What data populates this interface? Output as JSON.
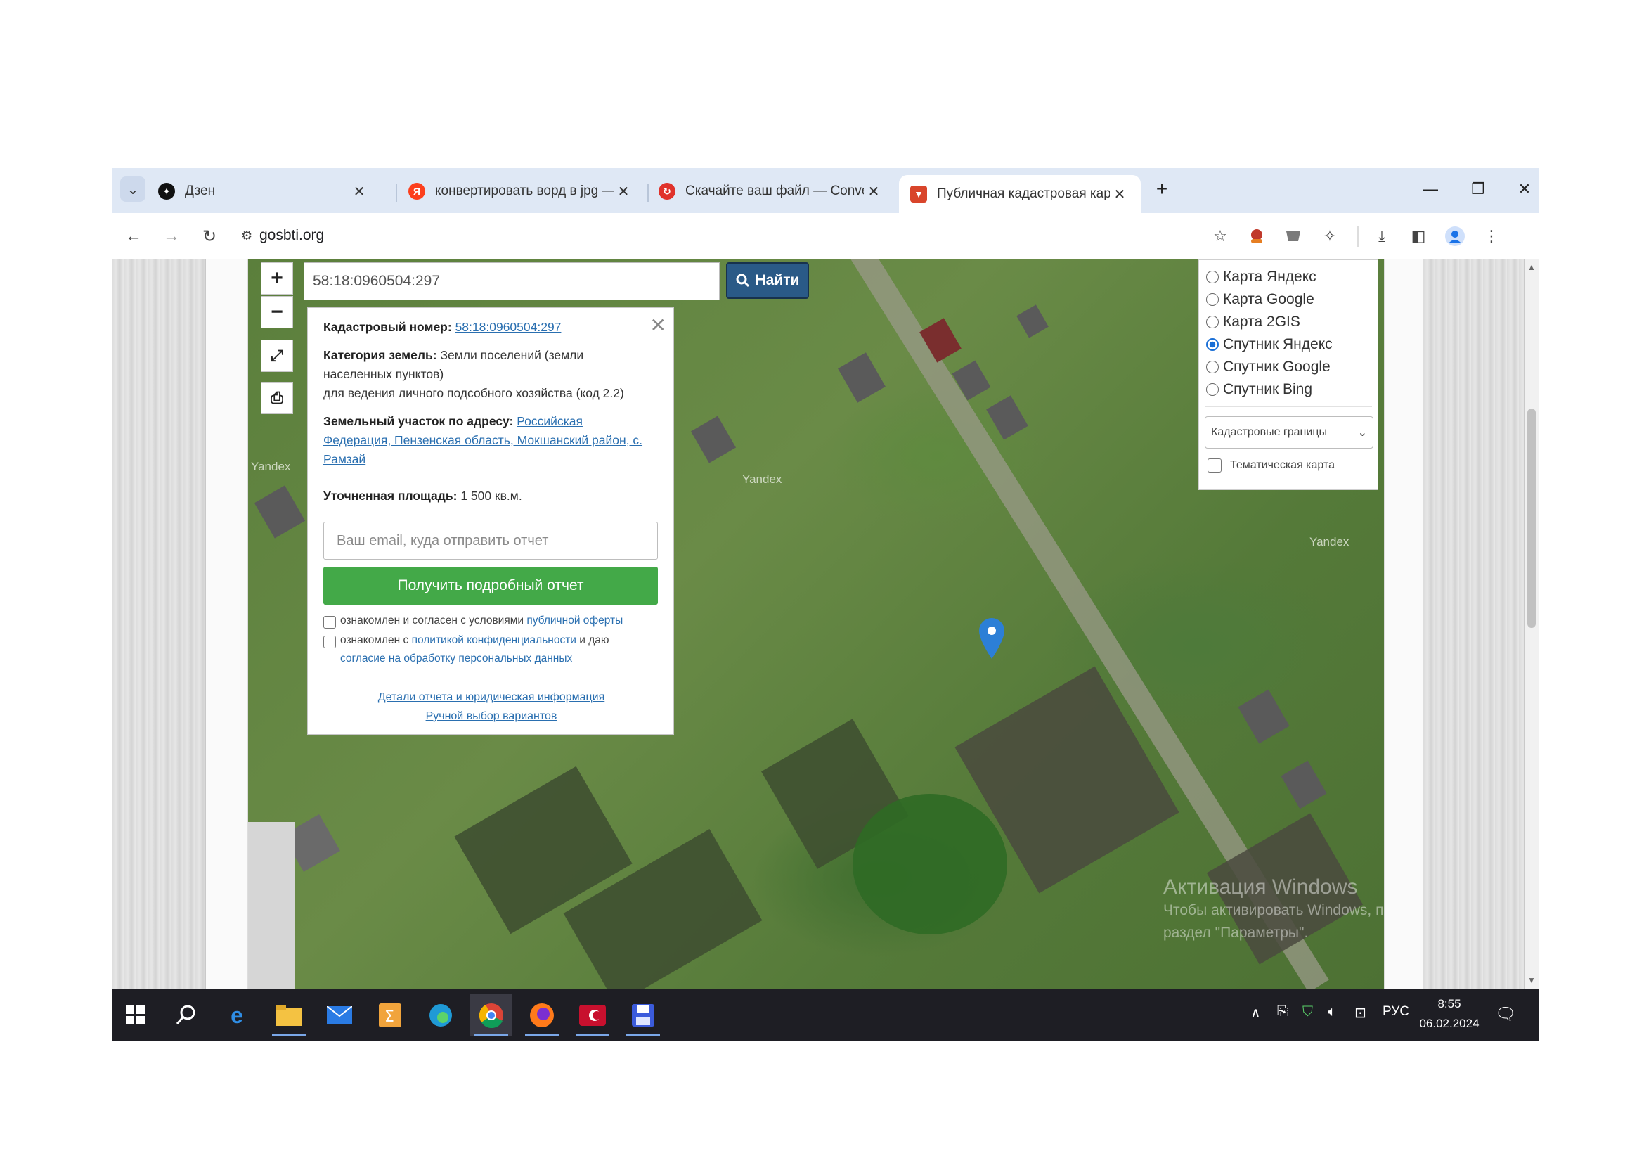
{
  "browser": {
    "tabs": [
      {
        "title": "Дзен",
        "icon": "dzen-icon"
      },
      {
        "title": "конвертировать ворд в jpg —",
        "icon": "yandex-icon"
      },
      {
        "title": "Скачайте ваш файл — Convert",
        "icon": "convertio-icon"
      },
      {
        "title": "Публичная кадастровая карта",
        "icon": "gosbti-icon"
      }
    ],
    "new_tab": "+",
    "url": "gosbti.org"
  },
  "map": {
    "search_value": "58:18:0960504:297",
    "search_button": "Найти",
    "zoom_in": "+",
    "zoom_out": "−",
    "labels": [
      "Yandex",
      "Yandex",
      "Yandex"
    ]
  },
  "popup": {
    "cad_label": "Кадастровый номер:",
    "cad_value": "58:18:0960504:297",
    "category_label": "Категория земель:",
    "category_value": "Земли поселений (земли",
    "category_value2": "населенных пунктов)",
    "usage": "для ведения личного подсобного хозяйства (код 2.2)",
    "address_label": "Земельный участок по адресу:",
    "address_line1": "Российская",
    "address_line2": "Федерация, Пензенская область, Мокшанский район, с.",
    "address_line3": "Рамзай",
    "area_label": "Уточненная площадь:",
    "area_value": "1 500 кв.м.",
    "email_placeholder": "Ваш email, куда отправить отчет",
    "report_button": "Получить подробный отчет",
    "agree1_text": "ознакомлен и согласен с условиями",
    "agree1_link": "публичной оферты",
    "agree2_text": "ознакомлен с",
    "agree2_link": "политикой конфиденциальности",
    "agree2_text2": "и даю",
    "agree2_link2": "согласие на обработку персональных данных",
    "details_link": "Детали отчета и юридическая информация",
    "manual_link": "Ручной выбор вариантов"
  },
  "layers": {
    "options": [
      {
        "label": "Карта Яндекс",
        "selected": false
      },
      {
        "label": "Карта Google",
        "selected": false
      },
      {
        "label": "Карта 2GIS",
        "selected": false
      },
      {
        "label": "Спутник Яндекс",
        "selected": true
      },
      {
        "label": "Спутник Google",
        "selected": false
      },
      {
        "label": "Спутник Bing",
        "selected": false
      }
    ],
    "select_value": "Кадастровые границы",
    "thematic_label": "Тематическая карта"
  },
  "watermark": {
    "line1": "Активация Windows",
    "line2": "Чтобы активировать Windows, перейдите в",
    "line3": "раздел \"Параметры\"."
  },
  "taskbar": {
    "lang": "РУС",
    "time": "8:55",
    "date": "06.02.2024"
  },
  "colors": {
    "accent_green": "#43a948",
    "search_button": "#2a5a87",
    "link": "#2a6fb0",
    "marker": "#2c7fd6"
  }
}
